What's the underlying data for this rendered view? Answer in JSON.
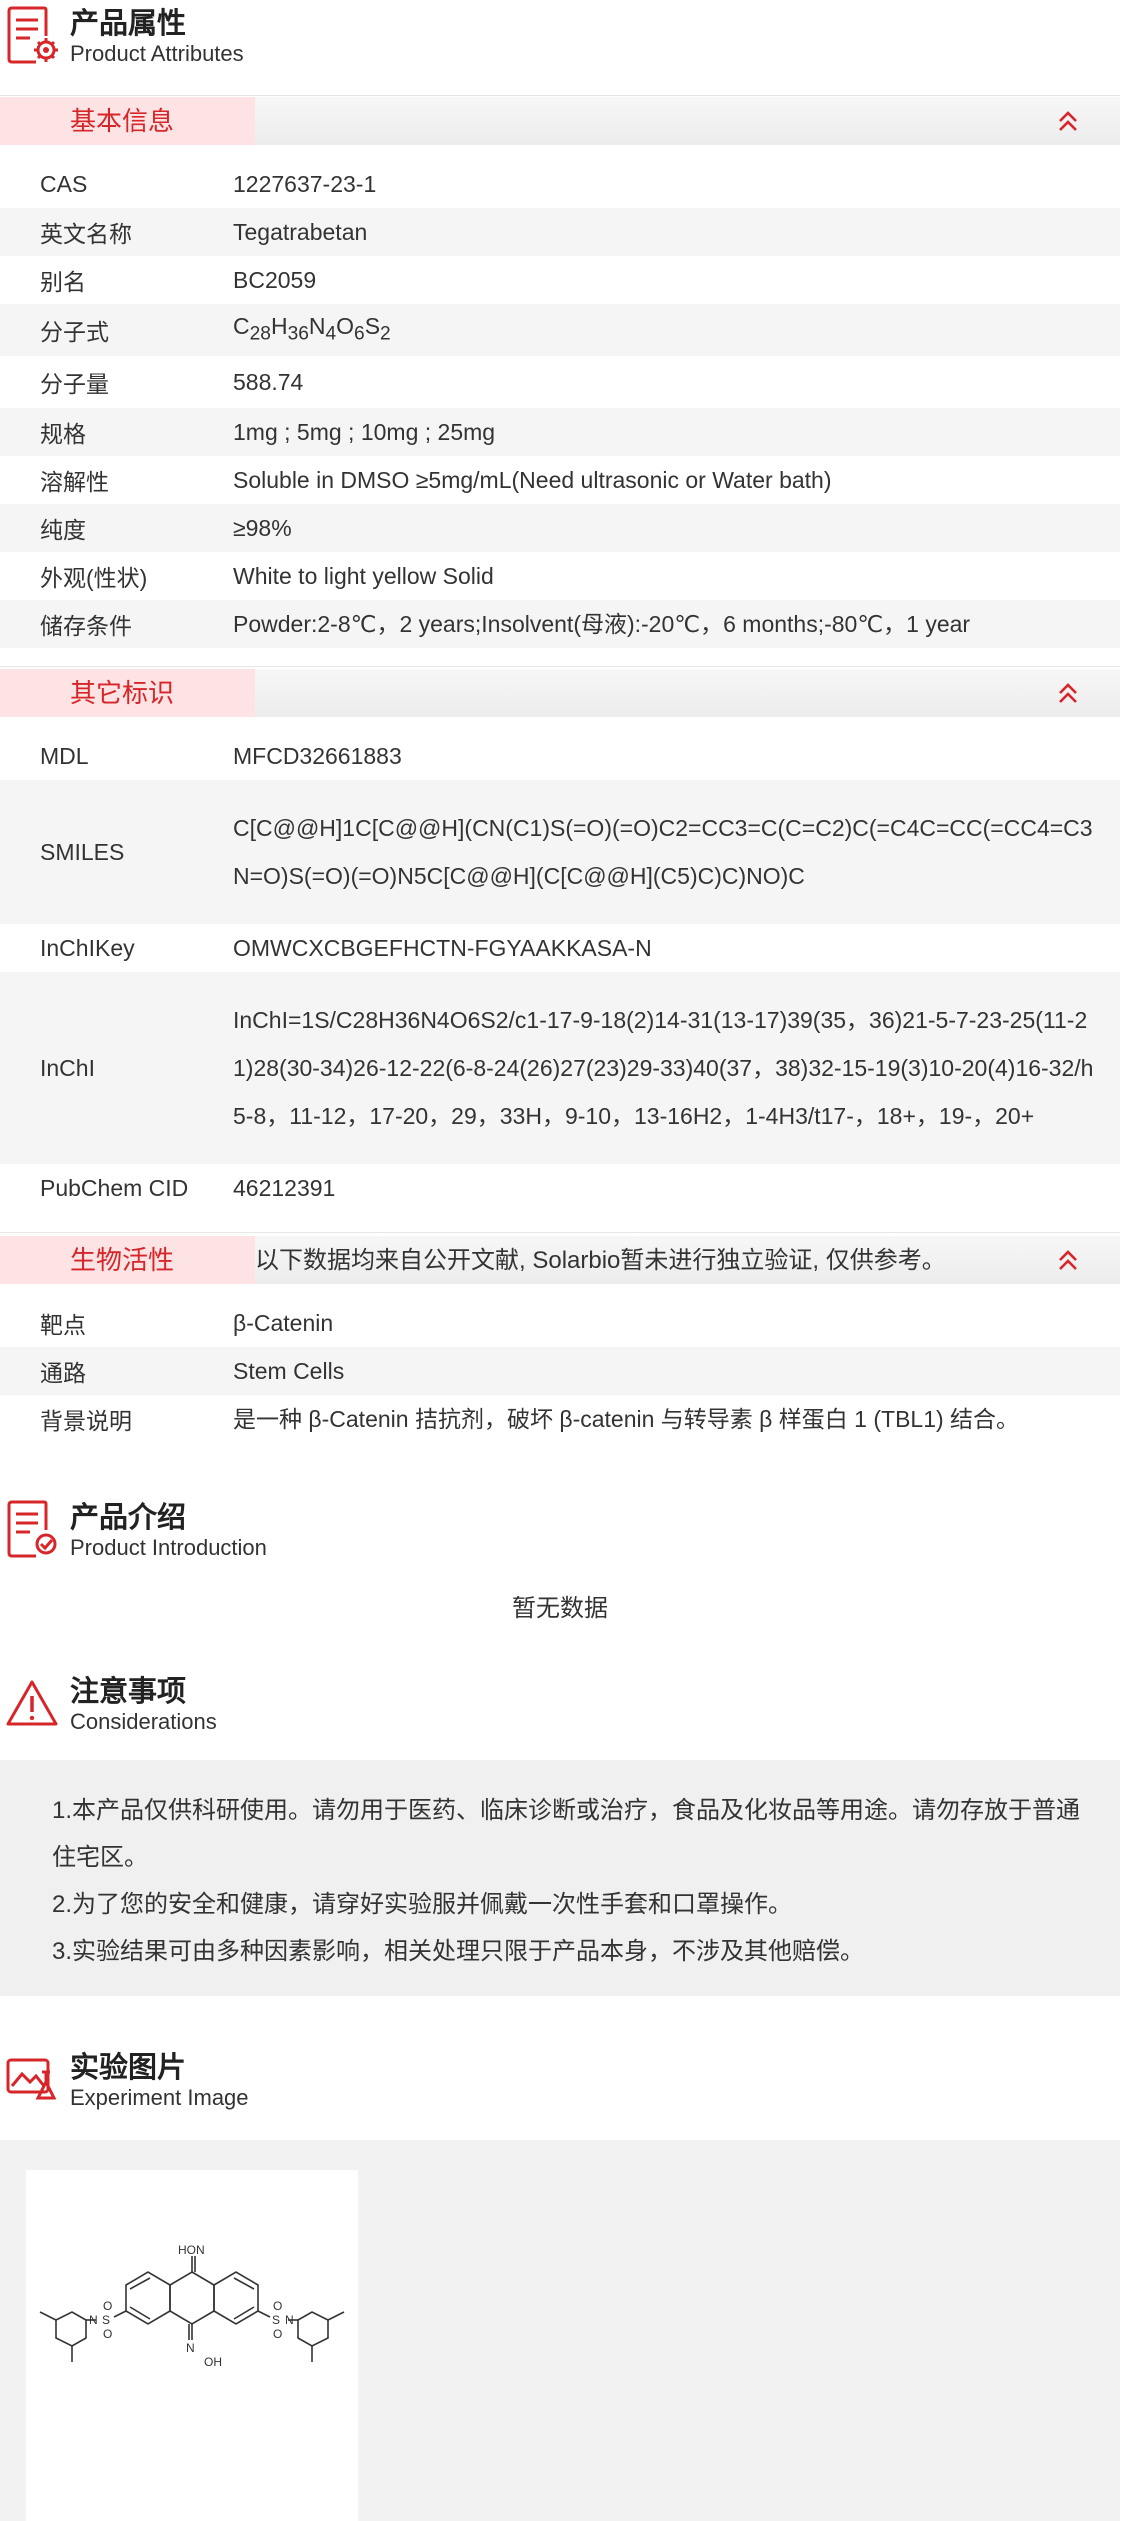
{
  "attributes_section": {
    "title_zh": "产品属性",
    "title_en": "Product Attributes"
  },
  "basic": {
    "label": "基本信息",
    "rows": [
      {
        "k": "CAS",
        "v": "1227637-23-1"
      },
      {
        "k": "英文名称",
        "v": "Tegatrabetan"
      },
      {
        "k": "别名",
        "v": "BC2059"
      },
      {
        "k": "分子式",
        "v": "C28H36N4O6S2"
      },
      {
        "k": "分子量",
        "v": "588.74"
      },
      {
        "k": "规格",
        "v": "1mg ; 5mg ; 10mg ; 25mg"
      },
      {
        "k": "溶解性",
        "v": "Soluble in DMSO ≥5mg/mL(Need ultrasonic or Water bath)"
      },
      {
        "k": "纯度",
        "v": "≥98%"
      },
      {
        "k": "外观(性状)",
        "v": "White to light yellow Solid"
      },
      {
        "k": "储存条件",
        "v": "Powder:2-8℃，2 years;Insolvent(母液):-20℃，6 months;-80℃，1 year"
      }
    ],
    "formula_parts": [
      "C",
      "28",
      "H",
      "36",
      "N",
      "4",
      "O",
      "6",
      "S",
      "2"
    ]
  },
  "other": {
    "label": "其它标识",
    "rows": [
      {
        "k": "MDL",
        "v": "MFCD32661883"
      },
      {
        "k": "SMILES",
        "v": "C[C@@H]1C[C@@H](CN(C1)S(=O)(=O)C2=CC3=C(C=C2)C(=C4C=CC(=CC4=C3N=O)S(=O)(=O)N5C[C@@H](C[C@@H](C5)C)C)NO)C"
      },
      {
        "k": "InChIKey",
        "v": "OMWCXCBGEFHCTN-FGYAAKKASA-N"
      },
      {
        "k": "InChI",
        "v": "InChI=1S/C28H36N4O6S2/c1-17-9-18(2)14-31(13-17)39(35，36)21-5-7-23-25(11-21)28(30-34)26-12-22(6-8-24(26)27(23)29-33)40(37，38)32-15-19(3)10-20(4)16-32/h5-8，11-12，17-20，29，33H，9-10，13-16H2，1-4H3/t17-，18+，19-，20+"
      },
      {
        "k": "PubChem CID",
        "v": "46212391"
      }
    ]
  },
  "bio": {
    "label": "生物活性",
    "note": "以下数据均来自公开文献, Solarbio暂未进行独立验证, 仅供参考。",
    "rows": [
      {
        "k": "靶点",
        "v": "β-Catenin"
      },
      {
        "k": "通路",
        "v": "Stem Cells"
      },
      {
        "k": "背景说明",
        "v": "是一种 β-Catenin 拮抗剂，破坏 β-catenin 与转导素 β 样蛋白 1 (TBL1) 结合。"
      }
    ]
  },
  "intro": {
    "title_zh": "产品介绍",
    "title_en": "Product Introduction",
    "empty": "暂无数据"
  },
  "considerations": {
    "title_zh": "注意事项",
    "title_en": "Considerations",
    "items": [
      "1.本产品仅供科研使用。请勿用于医药、临床诊断或治疗，食品及化妆品等用途。请勿存放于普通住宅区。",
      "2.为了您的安全和健康，请穿好实验服并佩戴一次性手套和口罩操作。",
      "3.实验结果可由多种因素影响，相关处理只限于产品本身，不涉及其他赔偿。"
    ]
  },
  "experiment": {
    "title_zh": "实验图片",
    "title_en": "Experiment Image",
    "structure_labels": [
      "HO",
      "N",
      "N",
      "OH",
      "N",
      "S",
      "O",
      "O",
      "N",
      "S",
      "O",
      "O"
    ]
  },
  "colors": {
    "accent": "#d7262a",
    "tag_bg": "#fde3e3"
  },
  "icons": {
    "collapse": "double-chevron-up-icon"
  }
}
